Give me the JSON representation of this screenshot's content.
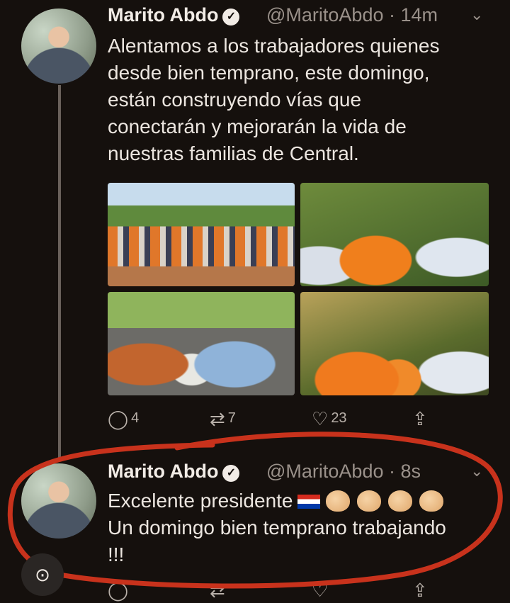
{
  "tweet1": {
    "author": "Marito Abdo",
    "handle": "@MaritoAbdo",
    "time": "· 14m",
    "lines": [
      "Alentamos a los trabajadores quienes",
      "desde bien temprano, este domingo,",
      "están construyendo vías que",
      "conectarán y mejorarán la vida de",
      "nuestras familias de Central."
    ],
    "replies": "4",
    "retweets": "7",
    "likes": "23"
  },
  "tweet2": {
    "author": "Marito Abdo",
    "handle": "@MaritoAbdo",
    "time": "· 8s",
    "line1": "Excelente presidente",
    "line2": "Un domingo bien temprano trabajando",
    "line3": "!!!"
  },
  "icons": {
    "reply": "speech-bubble-icon",
    "retweet": "retweet-arrows-icon",
    "like": "heart-icon",
    "share": "share-upload-icon",
    "verified": "verified-badge-icon",
    "menu": "chevron-down-icon",
    "lens": "lens-search-icon"
  },
  "colors": {
    "background": "#15100d",
    "annotation": "#c8321c",
    "flag_red": "#d52b1e",
    "flag_blue": "#0038a8"
  }
}
